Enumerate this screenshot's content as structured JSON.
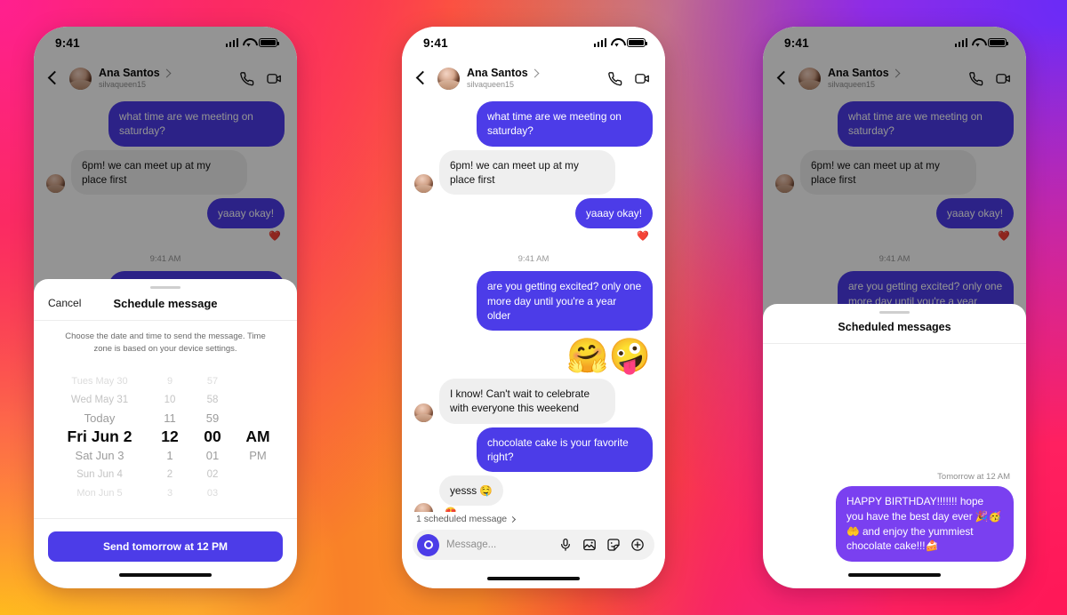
{
  "background": {
    "gradient_colors": [
      "#ffc419",
      "#f98128",
      "#ff2d55",
      "#ff1f8f",
      "#d329c6",
      "#8a33ec",
      "#6a2bf7"
    ]
  },
  "theme": {
    "bubble_out": "#4c3ce8",
    "bubble_out_bright": "#7a40f0",
    "bubble_in": "#efefef",
    "accent_button": "#4c3ce8"
  },
  "status_bar": {
    "time": "9:41"
  },
  "header": {
    "name": "Ana Santos",
    "username": "silvaqueen15",
    "back_icon": "back-chevron-icon",
    "name_chevron_icon": "chevron-right-icon",
    "call_icon": "phone-call-icon",
    "video_icon": "video-camera-icon"
  },
  "conversation": {
    "messages": [
      {
        "id": "m1",
        "side": "out",
        "text": "what time are we meeting on saturday?"
      },
      {
        "id": "m2",
        "side": "in",
        "text": "6pm! we can meet up at my place first"
      },
      {
        "id": "m3",
        "side": "out",
        "text": "yaaay okay!",
        "reaction": "❤️"
      },
      {
        "id": "t1",
        "type": "timestamp",
        "text": "9:41 AM"
      },
      {
        "id": "m4",
        "side": "out",
        "text": "are you getting excited? only one more day until you're a year older"
      },
      {
        "id": "m5",
        "side": "out",
        "type": "sticker",
        "text": "🤗🤪"
      },
      {
        "id": "m6",
        "side": "in",
        "text": "I know! Can't wait to celebrate with everyone this weekend"
      },
      {
        "id": "m7",
        "side": "out",
        "text": "chocolate cake is your favorite right?"
      },
      {
        "id": "m8",
        "side": "in",
        "text": "yesss 🤤",
        "reaction": "😍"
      }
    ]
  },
  "composer": {
    "scheduled_link": "1 scheduled message",
    "scheduled_link_chevron": "chevron-right-icon",
    "camera_icon": "camera-icon",
    "placeholder": "Message...",
    "mic_icon": "microphone-icon",
    "gallery_icon": "photo-gallery-icon",
    "sticker_icon": "sticker-icon",
    "plus_icon": "plus-circle-icon"
  },
  "schedule_sheet": {
    "cancel_label": "Cancel",
    "title": "Schedule message",
    "description": "Choose the date and time to send the message. Time zone is based on your device settings.",
    "picker": {
      "dates": [
        "Tues May 30",
        "Wed May 31",
        "Today",
        "Fri Jun 2",
        "Sat Jun 3",
        "Sun Jun 4",
        "Mon Jun 5"
      ],
      "hours": [
        "9",
        "10",
        "11",
        "12",
        "1",
        "2",
        "3"
      ],
      "minutes": [
        "57",
        "58",
        "59",
        "00",
        "01",
        "02",
        "03"
      ],
      "meridiem": [
        "",
        "",
        "",
        "AM",
        "PM",
        "",
        ""
      ],
      "selected_index": 3,
      "selected_date": "Fri Jun 2",
      "selected_hour": "12",
      "selected_minute": "00",
      "selected_meridiem": "AM"
    },
    "send_button": "Send tomorrow at 12 PM"
  },
  "scheduled_sheet": {
    "title": "Scheduled messages",
    "when": "Tomorrow at 12 AM",
    "message": "HAPPY BIRTHDAY!!!!!!! hope you have the best day ever 🎉🥳🤲 and enjoy the yummiest chocolate cake!!!🍰"
  }
}
